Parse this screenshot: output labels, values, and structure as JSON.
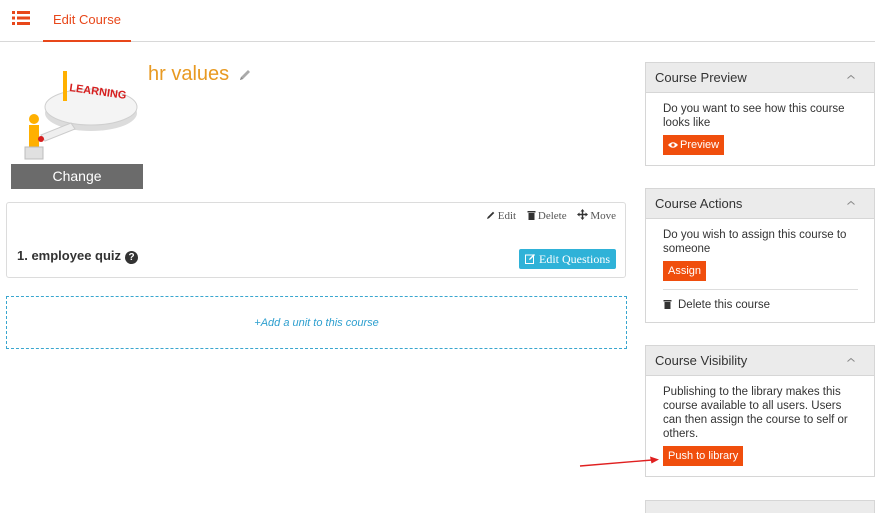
{
  "topbar": {
    "tab_label": "Edit Course"
  },
  "course": {
    "title": "hr values",
    "thumbnail_text": "LEARNING",
    "change_label": "Change"
  },
  "unit": {
    "name": "1. employee quiz",
    "help_glyph": "?",
    "actions": {
      "edit": "Edit",
      "delete": "Delete",
      "move": "Move"
    },
    "edit_questions_label": "Edit Questions"
  },
  "add_unit_label": "+Add a unit to this course",
  "panels": {
    "preview": {
      "title": "Course Preview",
      "text": "Do you want to see how this course looks like",
      "button": "Preview"
    },
    "actions": {
      "title": "Course Actions",
      "text": "Do you wish to assign this course to someone",
      "button": "Assign",
      "delete_label": "Delete this course"
    },
    "visibility": {
      "title": "Course Visibility",
      "text": "Publishing to the library makes this course available to all users. Users can then assign the course to self or others.",
      "button": "Push to library"
    }
  },
  "colors": {
    "accent_orange": "#e8471a",
    "button_orange": "#f04e0d",
    "title_orange": "#e89a22",
    "info_blue": "#2fb2d8",
    "arrow_red": "#e02020"
  }
}
